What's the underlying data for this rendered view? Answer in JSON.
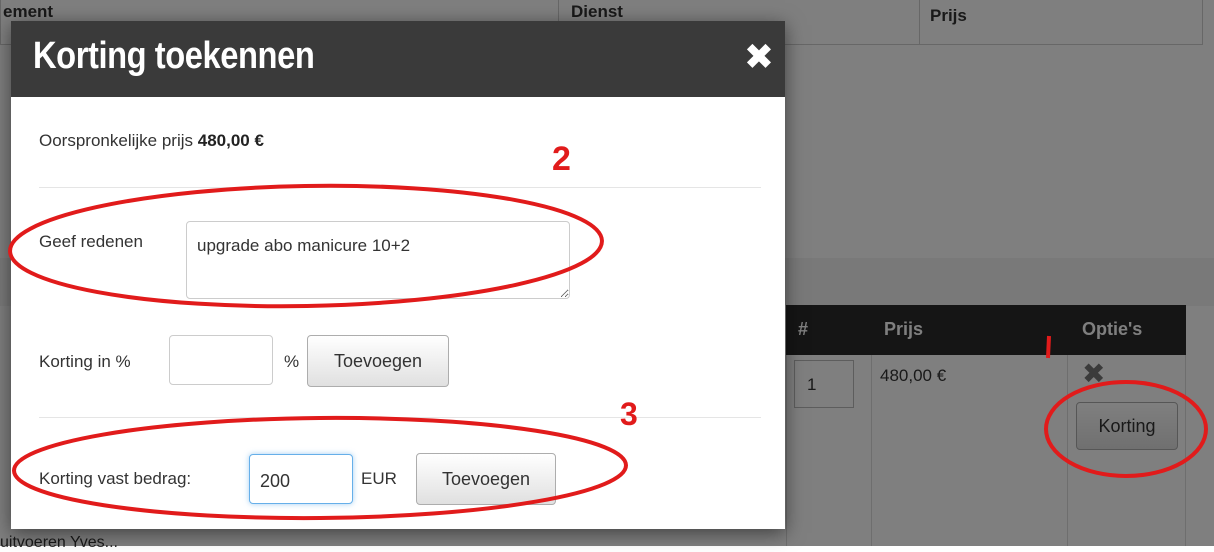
{
  "background": {
    "top_table": {
      "headers": [
        "ement",
        "Dienst",
        "Prijs"
      ]
    },
    "order_table": {
      "headers": [
        "#",
        "Prijs",
        "Optie's"
      ],
      "row": {
        "quantity": "1",
        "price": "480,00 €",
        "delete_icon": "x-icon",
        "discount_button": "Korting"
      }
    },
    "bottom_text": "uitvoeren Yves..."
  },
  "modal": {
    "title": "Korting toekennen",
    "close_icon": "close-icon",
    "original_price_label": "Oorspronkelijke prijs",
    "original_price_value": "480,00 €",
    "reason_label": "Geef redenen",
    "reason_value": "upgrade abo manicure 10+2",
    "percent_label": "Korting in %",
    "percent_value": "",
    "percent_unit": "%",
    "percent_add_button": "Toevoegen",
    "fixed_label": "Korting vast bedrag:",
    "fixed_value": "200",
    "fixed_unit": "EUR",
    "fixed_add_button": "Toevoegen"
  },
  "annotations": {
    "color": "#e11b1b",
    "marks": [
      "1",
      "2",
      "3"
    ]
  }
}
